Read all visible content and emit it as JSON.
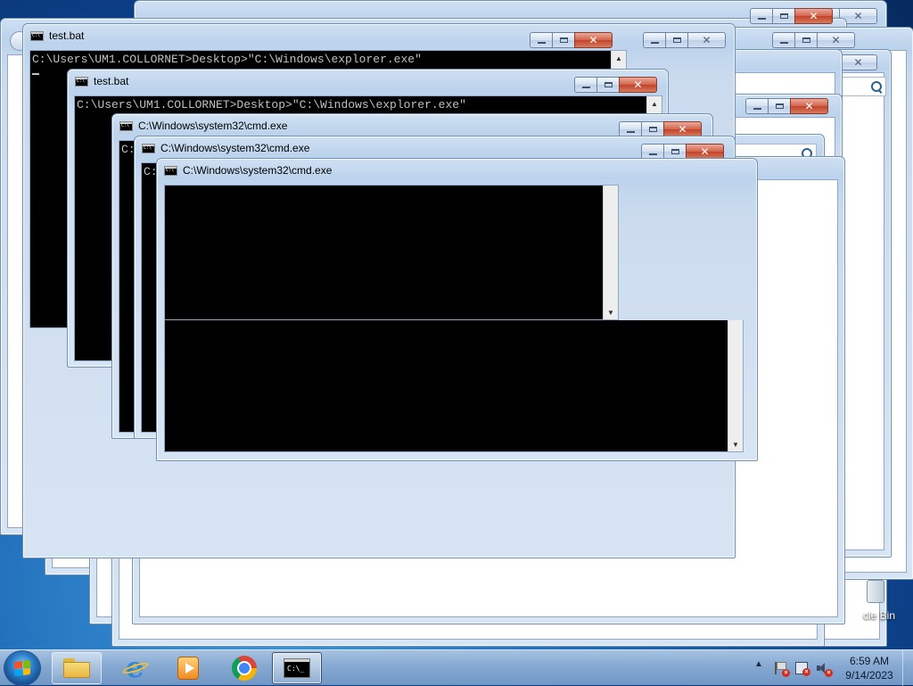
{
  "windows": {
    "batch_1": {
      "title": "test.bat",
      "console_line": "C:\\Users\\UM1.COLLORNET>Desktop>\"C:\\Windows\\explorer.exe\""
    },
    "batch_2": {
      "title": "test.bat",
      "console_line": "C:\\Users\\UM1.COLLORNET>Desktop>\"C:\\Windows\\explorer.exe\""
    },
    "cmd_1": {
      "title": "C:\\Windows\\system32\\cmd.exe",
      "console_line": "C:"
    },
    "cmd_2": {
      "title": "C:\\Windows\\system32\\cmd.exe",
      "console_line": "C:"
    },
    "cmd_3": {
      "title": "C:\\Windows\\system32\\cmd.exe"
    }
  },
  "icons": {
    "minimize": "minimize-icon",
    "maximize": "maximize-icon",
    "close": "close-icon",
    "close_glyph": "✕",
    "scroll_up": "▲",
    "scroll_down": "▼"
  },
  "desktop": {
    "recycle_bin_label": "cle Bin"
  },
  "taskbar": {
    "pinned": [
      "Windows Explorer",
      "Internet Explorer",
      "Windows Media Player",
      "Google Chrome",
      "Command Prompt"
    ],
    "tray_arrow": "▲",
    "clock": {
      "time": "6:59 AM",
      "date": "9/14/2023"
    }
  },
  "colors": {
    "console_bg": "#000000",
    "console_text": "#c0c0c0",
    "close_button": "#c2442a",
    "frame": "#bcd3ec"
  }
}
